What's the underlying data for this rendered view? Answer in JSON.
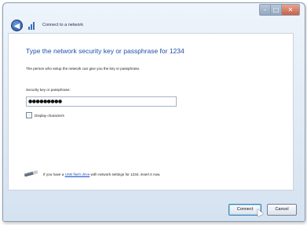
{
  "window": {
    "controls": {
      "minimize_glyph": "–",
      "maximize_glyph": "□",
      "close_glyph": "✕"
    }
  },
  "nav": {
    "back_glyph": "◀",
    "title": "Connect to a network",
    "icon": "network-signal-icon"
  },
  "content": {
    "heading": "Type the network security key or passphrase for 1234",
    "description": "The person who setup the network can give you the key or passphrase.",
    "key_label": "Security key or passphrase:",
    "key_value": "●●●●●●●●●",
    "display_characters_label": "Display characters",
    "display_characters_checked": false,
    "usb": {
      "icon": "usb-drive-icon",
      "text_before": "If you have a",
      "link_text": "USB flash drive",
      "text_after": "with network settings for 1234, insert it now."
    }
  },
  "buttons": {
    "connect": "Connect",
    "cancel": "Cancel"
  },
  "colors": {
    "heading": "#1f4fa8",
    "link": "#1a4fc2",
    "window_frame": "#d5e2f0",
    "close_button": "#c9604a"
  }
}
